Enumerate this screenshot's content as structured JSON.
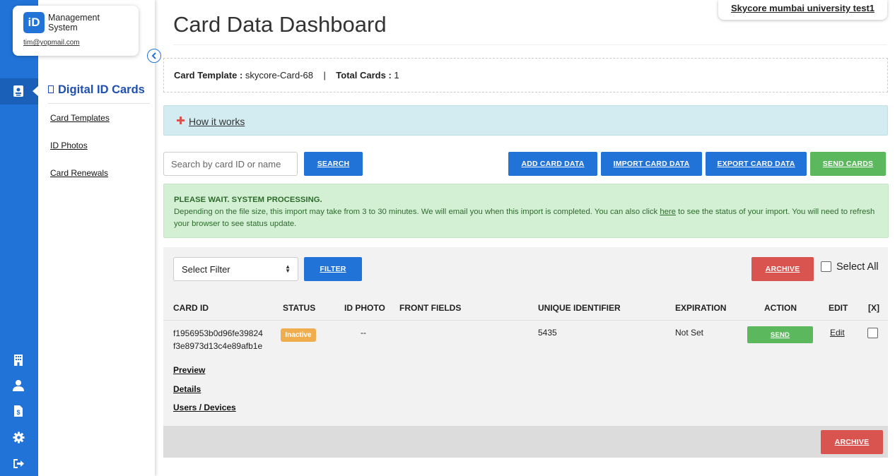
{
  "brand": {
    "logo_text": "iD",
    "name": "Management System",
    "email": "tim@yopmail.com"
  },
  "org_name": "Skycore mumbai university test1",
  "page_title": "Card Data Dashboard",
  "template_info": {
    "template_label": "Card Template :",
    "template_value": "skycore-Card-68",
    "separator": "|",
    "total_label": "Total Cards :",
    "total_value": "1"
  },
  "sidebar": {
    "title": "Digital ID Cards",
    "links": [
      "Card Templates",
      "ID Photos",
      "Card Renewals"
    ]
  },
  "rail_icons": [
    "id-card-icon",
    "building-icon",
    "user-icon",
    "invoice-icon",
    "gear-icon",
    "logout-icon"
  ],
  "how_it_works": "How it works",
  "search": {
    "placeholder": "Search by card ID or name",
    "button": "SEARCH"
  },
  "actions": {
    "add": "ADD CARD DATA",
    "import": "IMPORT CARD DATA",
    "export": "EXPORT CARD DATA",
    "send": "SEND CARDS"
  },
  "alert": {
    "heading": "PLEASE WAIT. SYSTEM PROCESSING.",
    "text_before": "Depending on the file size, this import may take from 3 to 30 minutes. We will email you when this import is completed. You can also click ",
    "link": "here",
    "text_after": " to see the status of your import. You will need to refresh your browser to see status update."
  },
  "filter": {
    "select_value": "Select Filter",
    "button": "FILTER",
    "archive": "ARCHIVE",
    "select_all": "Select All"
  },
  "table": {
    "headers": {
      "card_id": "CARD ID",
      "status": "STATUS",
      "id_photo": "ID PHOTO",
      "front_fields": "FRONT FIELDS",
      "unique_id": "UNIQUE IDENTIFIER",
      "expiration": "EXPIRATION",
      "action": "ACTION",
      "edit": "EDIT",
      "x": "[X]"
    },
    "rows": [
      {
        "card_id": "f1956953b0d96fe39824f3e8973d13c4e89afb1e",
        "status": "Inactive",
        "id_photo": "--",
        "unique_id": "5435",
        "expiration": "Not Set",
        "action": "SEND",
        "edit": "Edit",
        "links": {
          "preview": "Preview",
          "details": "Details",
          "users": "Users / Devices"
        }
      }
    ]
  },
  "footer_archive": "ARCHIVE",
  "colors": {
    "primary": "#2273d8",
    "success": "#5cb85c",
    "danger": "#d9534f",
    "warning": "#f0ad4e"
  }
}
